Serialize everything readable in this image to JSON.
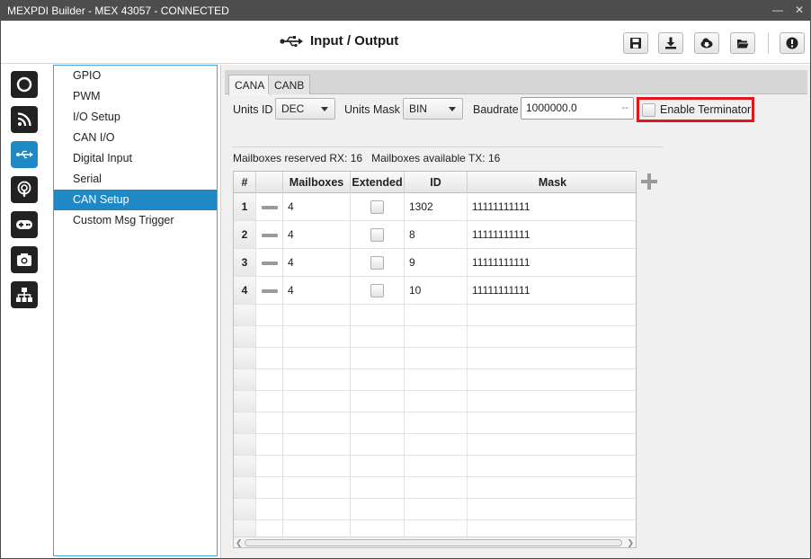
{
  "window": {
    "title": "MEXPDI Builder - MEX 43057 - CONNECTED"
  },
  "header": {
    "title": "Input / Output"
  },
  "menu": {
    "items": [
      "GPIO",
      "PWM",
      "I/O Setup",
      "CAN I/O",
      "Digital Input",
      "Serial",
      "CAN Setup",
      "Custom Msg Trigger"
    ],
    "selected": "CAN Setup"
  },
  "tabs": [
    {
      "label": "CANA",
      "active": true
    },
    {
      "label": "CANB",
      "active": false
    }
  ],
  "controls": {
    "units_id_label": "Units ID",
    "units_id_value": "DEC",
    "units_mask_label": "Units Mask",
    "units_mask_value": "BIN",
    "baudrate_label": "Baudrate",
    "baudrate_value": "1000000.0",
    "baudrate_unit": "--",
    "enable_terminator_label": "Enable Terminator",
    "enable_terminator_checked": false
  },
  "info": {
    "reserved_rx_label": "Mailboxes reserved RX:",
    "reserved_rx": "16",
    "available_tx_label": "Mailboxes available TX:",
    "available_tx": "16"
  },
  "table": {
    "columns": [
      "#",
      "",
      "Mailboxes",
      "Extended",
      "ID",
      "Mask"
    ],
    "rows": [
      {
        "num": "1",
        "mailboxes": "4",
        "extended": false,
        "id": "1302",
        "mask": "11111111111"
      },
      {
        "num": "2",
        "mailboxes": "4",
        "extended": false,
        "id": "8",
        "mask": "11111111111"
      },
      {
        "num": "3",
        "mailboxes": "4",
        "extended": false,
        "id": "9",
        "mask": "11111111111"
      },
      {
        "num": "4",
        "mailboxes": "4",
        "extended": false,
        "id": "10",
        "mask": "11111111111"
      }
    ]
  },
  "colors": {
    "accent": "#1f89c6",
    "highlight_border": "#e0161e",
    "titlebar": "#4d4d4d"
  },
  "icons": {
    "header_buttons": [
      "save-icon",
      "download-icon",
      "cloud-download-icon",
      "folder-open-icon",
      "info-icon"
    ],
    "nav": [
      "power-icon",
      "rss-icon",
      "usb-icon",
      "podcast-icon",
      "gamepad-icon",
      "camera-icon",
      "sitemap-icon"
    ]
  }
}
